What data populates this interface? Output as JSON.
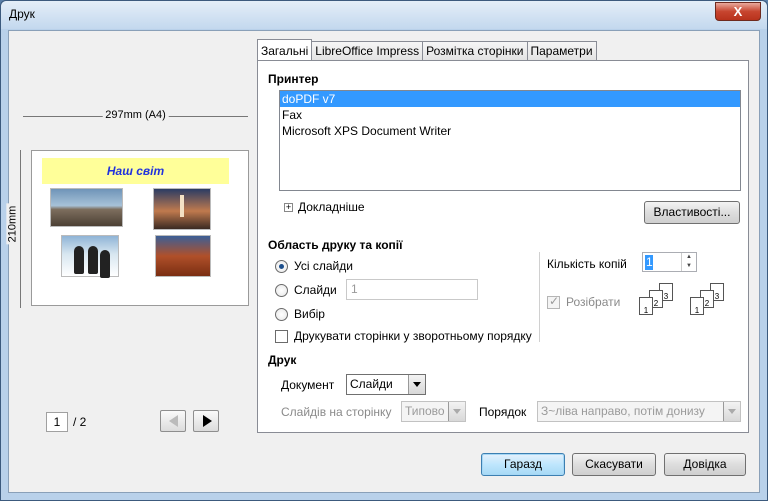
{
  "window": {
    "title": "Друк",
    "close_label": "X"
  },
  "preview": {
    "paper_width_label": "297mm (A4)",
    "paper_height_label": "210mm",
    "slide_title": "Наш світ",
    "page_current": "1",
    "page_total": "/ 2"
  },
  "tabs": [
    {
      "label": "Загальні",
      "active": true
    },
    {
      "label": "LibreOffice Impress",
      "active": false
    },
    {
      "label": "Розмітка сторінки",
      "active": false
    },
    {
      "label": "Параметри",
      "active": false
    }
  ],
  "printer": {
    "heading": "Принтер",
    "items": [
      "doPDF v7",
      "Fax",
      "Microsoft XPS Document Writer"
    ],
    "selected": "doPDF v7",
    "details_label": "Докладніше",
    "properties_button": "Властивості..."
  },
  "range": {
    "heading": "Область друку та копії",
    "all_slides": "Усі слайди",
    "slides": "Слайди",
    "slides_value": "1",
    "selection": "Вибір",
    "reverse_order": "Друкувати сторінки у зворотньому порядку",
    "copies_label": "Кількість копій",
    "copies_value": "1",
    "collate_label": "Розібрати"
  },
  "print": {
    "heading": "Друк",
    "document_label": "Документ",
    "document_value": "Слайди",
    "slides_per_page_label": "Слайдів на сторінку",
    "slides_per_page_value": "Типово",
    "order_label": "Порядок",
    "order_value": "З~ліва направо, потім донизу"
  },
  "buttons": {
    "ok": "Гаразд",
    "cancel": "Скасувати",
    "help": "Довідка"
  }
}
